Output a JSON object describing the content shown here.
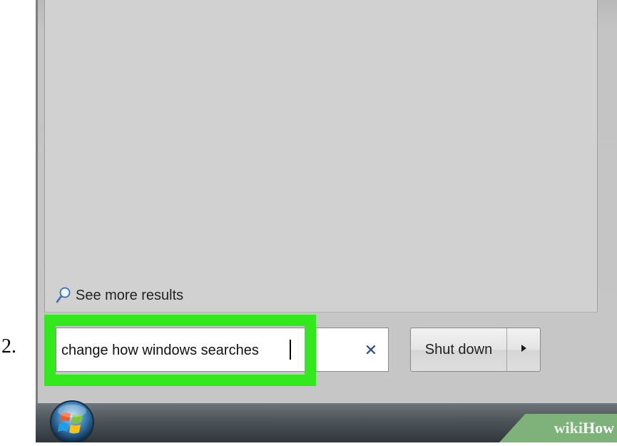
{
  "step": {
    "number": "2."
  },
  "start_menu": {
    "see_more_label": "See more results",
    "search": {
      "value": "change how windows searches",
      "clear_icon": "✕"
    },
    "shutdown": {
      "label": "Shut down",
      "arrow_icon": "▸"
    }
  },
  "taskbar": {
    "start_icon": "windows-start-orb"
  },
  "watermark": {
    "part1": "wiki",
    "part2": "How"
  },
  "colors": {
    "highlight": "#33e81c",
    "menu_bg": "#c6c6c6",
    "taskbar": "#4f565c"
  }
}
